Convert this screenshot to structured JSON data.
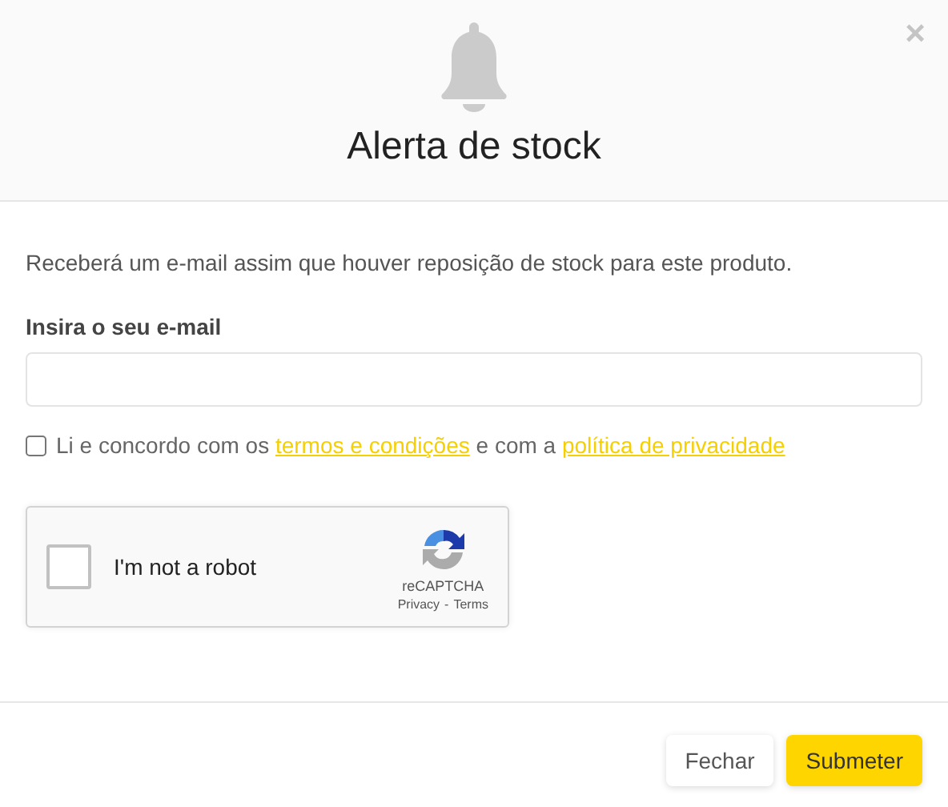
{
  "dialog": {
    "title": "Alerta de stock",
    "close": "×"
  },
  "message": "Receberá um e-mail assim que houver reposição de stock para este produto.",
  "email": {
    "label": "Insira o seu e-mail"
  },
  "agreement": {
    "checked": false,
    "parts": [
      {
        "kind": "text",
        "text": "Li e concordo com os "
      },
      {
        "kind": "link",
        "text": "termos e condições"
      },
      {
        "kind": "text",
        "text": " e com a "
      },
      {
        "kind": "link",
        "text": "política de privacidade"
      }
    ]
  },
  "captcha": {
    "checked": false,
    "label": "I'm not a robot",
    "brand": "reCAPTCHA",
    "links": [
      "Privacy",
      "Terms"
    ],
    "separator": "-"
  },
  "buttons": [
    {
      "label": "Fechar",
      "kind": "secondary"
    },
    {
      "label": "Submeter",
      "kind": "primary"
    }
  ]
}
